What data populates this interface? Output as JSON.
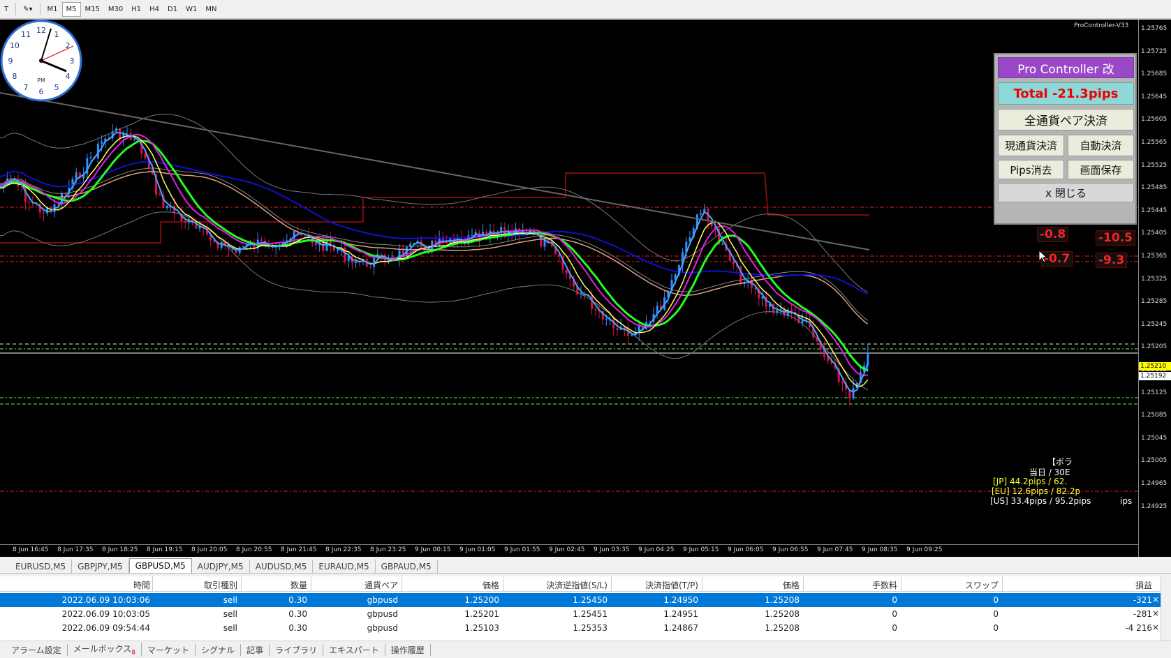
{
  "toolbar": {
    "timeframes": [
      "M1",
      "M5",
      "M15",
      "M30",
      "H1",
      "H4",
      "D1",
      "W1",
      "MN"
    ],
    "active_timeframe": "M5"
  },
  "chart": {
    "indicator_label": "ProController-V33",
    "price_ticks": [
      "1.25765",
      "1.25725",
      "1.25685",
      "1.25645",
      "1.25605",
      "1.25565",
      "1.25525",
      "1.25485",
      "1.25445",
      "1.25405",
      "1.25365",
      "1.25325",
      "1.25285",
      "1.25245",
      "1.25205",
      "1.25165",
      "1.25125",
      "1.25085",
      "1.25045",
      "1.25005",
      "1.24965",
      "1.24925"
    ],
    "time_ticks": [
      "8 Jun 16:45",
      "8 Jun 17:35",
      "8 Jun 18:25",
      "8 Jun 19:15",
      "8 Jun 20:05",
      "8 Jun 20:55",
      "8 Jun 21:45",
      "8 Jun 22:35",
      "8 Jun 23:25",
      "9 Jun 00:15",
      "9 Jun 01:05",
      "9 Jun 01:55",
      "9 Jun 02:45",
      "9 Jun 03:35",
      "9 Jun 04:25",
      "9 Jun 05:15",
      "9 Jun 06:05",
      "9 Jun 06:55",
      "9 Jun 07:45",
      "9 Jun 08:35",
      "9 Jun 09:25"
    ],
    "price_tag_yellow": "1.25210",
    "price_tag_white": "1.25192",
    "colors": {
      "bull": "#2f8fff",
      "bear": "#e0104a",
      "ma_yellow": "#ffff66",
      "ma_magenta": "#e020e0",
      "ma_green": "#20ff20",
      "ma_blue": "#1010d0",
      "ma_salmon": "#e0a080",
      "ma_cyan": "#40a8ff"
    }
  },
  "pro_controller": {
    "title": "Pro Controller 改",
    "total": "Total   -21.3pips",
    "all_pairs_close": "全通貨ペア決済",
    "current_close": "現通貨決済",
    "auto_close": "自動決済",
    "pips_clear": "Pips消去",
    "screen_save": "画面保存",
    "close": "x 閉じる"
  },
  "pips_labels": [
    "-0.8",
    "-10.5",
    "-0.7",
    "-9.3"
  ],
  "session": {
    "line1": "【ボラ",
    "line2": "当日 / 30E",
    "jp": "[JP] 44.2pips / 62.",
    "eu": "[EU] 12.6pips / 82.2p",
    "us": "[US] 33.4pips / 95.2pips",
    "us_tail": "ips"
  },
  "tabs": [
    "EURUSD,M5",
    "GBPJPY,M5",
    "GBPUSD,M5",
    "AUDJPY,M5",
    "AUDUSD,M5",
    "EURAUD,M5",
    "GBPAUD,M5"
  ],
  "active_tab": "GBPUSD,M5",
  "table": {
    "headers": [
      "時間",
      "取引種別",
      "数量",
      "通貨ペア",
      "価格",
      "決済逆指値(S/L)",
      "決済指値(T/P)",
      "価格",
      "手数料",
      "スワップ",
      "損益"
    ],
    "rows": [
      [
        "2022.06.09 10:03:06",
        "sell",
        "0.30",
        "gbpusd",
        "1.25200",
        "1.25450",
        "1.24950",
        "1.25208",
        "0",
        "0",
        "-321"
      ],
      [
        "2022.06.09 10:03:05",
        "sell",
        "0.30",
        "gbpusd",
        "1.25201",
        "1.25451",
        "1.24951",
        "1.25208",
        "0",
        "0",
        "-281"
      ],
      [
        "2022.06.09 09:54:44",
        "sell",
        "0.30",
        "gbpusd",
        "1.25103",
        "1.25353",
        "1.24867",
        "1.25208",
        "0",
        "0",
        "-4 216"
      ]
    ]
  },
  "bottom_tabs": [
    "アラーム設定",
    "メールボックス",
    "マーケット",
    "シグナル",
    "記事",
    "ライブラリ",
    "エキスパート",
    "操作履歴"
  ],
  "mailbox_count": "8"
}
